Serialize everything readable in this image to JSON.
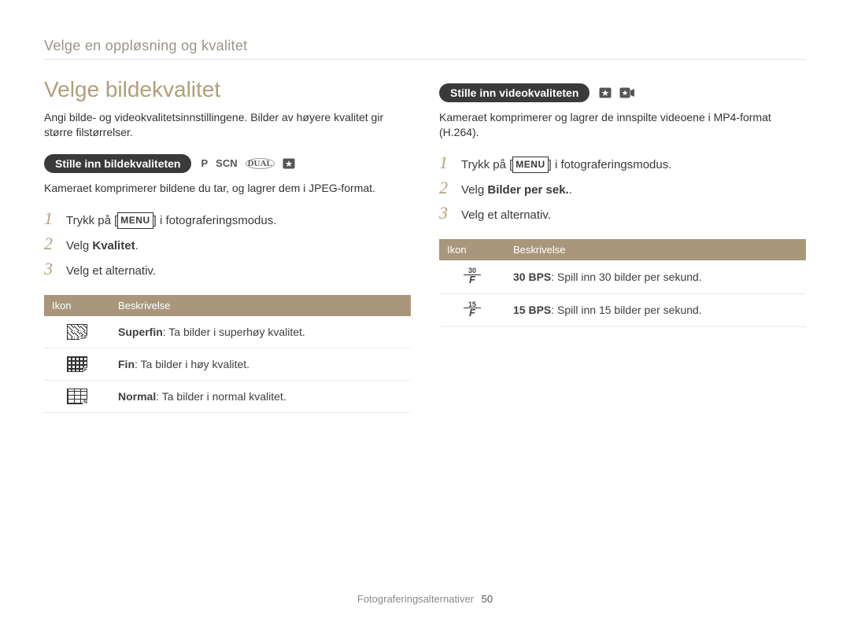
{
  "breadcrumb": "Velge en oppløsning og kvalitet",
  "left": {
    "title": "Velge bildekvalitet",
    "intro": "Angi bilde- og videokvalitetsinnstillingene. Bilder av høyere kvalitet gir større filstørrelser.",
    "pill": "Stille inn bildekvaliteten",
    "mode_p": "P",
    "mode_scn": "SCN",
    "mode_dual": "DUAL",
    "subtext": "Kameraet komprimerer bildene du tar, og lagrer dem i JPEG-format.",
    "steps": {
      "s1_pre": "Trykk på [",
      "s1_menu": "MENU",
      "s1_post": "] i fotograferingsmodus.",
      "s2_pre": "Velg ",
      "s2_bold": "Kvalitet",
      "s2_post": ".",
      "s3": "Velg et alternativ."
    },
    "table": {
      "h_icon": "Ikon",
      "h_desc": "Beskrivelse",
      "r1_bold": "Superfin",
      "r1_rest": ": Ta bilder i superhøy kvalitet.",
      "r2_bold": "Fin",
      "r2_rest": ": Ta bilder i høy kvalitet.",
      "r3_bold": "Normal",
      "r3_rest": ": Ta bilder i normal kvalitet."
    }
  },
  "right": {
    "pill": "Stille inn videokvaliteten",
    "subtext": "Kameraet komprimerer og lagrer de innspilte videoene i MP4-format (H.264).",
    "steps": {
      "s1_pre": "Trykk på [",
      "s1_menu": "MENU",
      "s1_post": "] i fotograferingsmodus.",
      "s2_pre": "Velg ",
      "s2_bold": "Bilder per sek.",
      "s2_post": ".",
      "s3": "Velg et alternativ."
    },
    "table": {
      "h_icon": "Ikon",
      "h_desc": "Beskrivelse",
      "r1_fps": "30",
      "r1_bold": "30 BPS",
      "r1_rest": ": Spill inn 30 bilder per sekund.",
      "r2_fps": "15",
      "r2_bold": "15 BPS",
      "r2_rest": ": Spill inn 15 bilder per sekund."
    }
  },
  "footer": {
    "section": "Fotograferingsalternativer",
    "page": "50"
  }
}
